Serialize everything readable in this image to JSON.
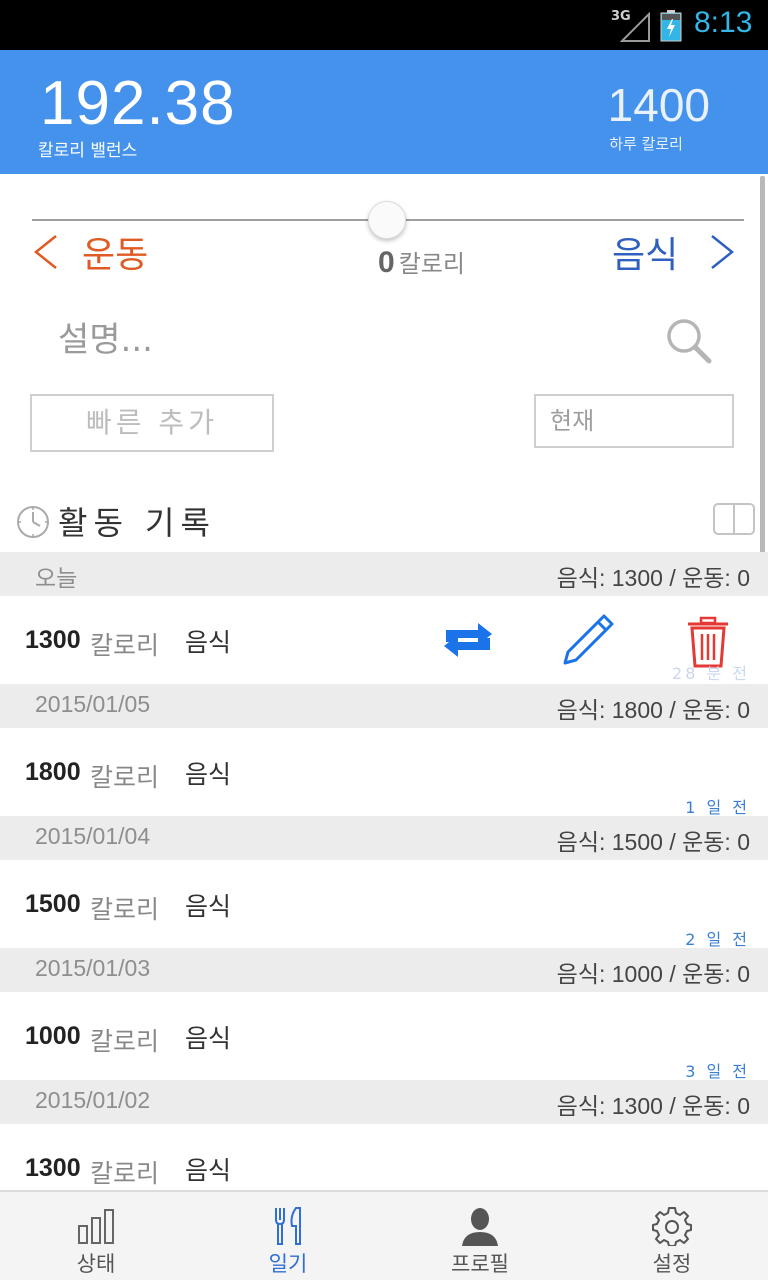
{
  "status_bar": {
    "network": "3G",
    "time": "8:13"
  },
  "header": {
    "balance": "192.38",
    "balance_label": "칼로리 밸런스",
    "daily": "1400",
    "daily_label": "하루 칼로리"
  },
  "slider": {
    "exercise_label": "운동",
    "food_label": "음식",
    "calories_value": "0",
    "calories_unit": "칼로리"
  },
  "search": {
    "placeholder": "설명..."
  },
  "quick_add_label": "빠른 추가",
  "time_field": "현재",
  "log": {
    "title": "활동 기록",
    "days": [
      {
        "date": "오늘",
        "summary": "음식: 1300 / 운동: 0",
        "entry": {
          "value": "1300",
          "unit": "칼로리",
          "kind": "음식",
          "ago": "28 분 전"
        }
      },
      {
        "date": "2015/01/05",
        "summary": "음식: 1800 / 운동: 0",
        "entry": {
          "value": "1800",
          "unit": "칼로리",
          "kind": "음식",
          "ago": "1 일 전"
        }
      },
      {
        "date": "2015/01/04",
        "summary": "음식: 1500 / 운동: 0",
        "entry": {
          "value": "1500",
          "unit": "칼로리",
          "kind": "음식",
          "ago": "2 일 전"
        }
      },
      {
        "date": "2015/01/03",
        "summary": "음식: 1000 / 운동: 0",
        "entry": {
          "value": "1000",
          "unit": "칼로리",
          "kind": "음식",
          "ago": "3 일 전"
        }
      },
      {
        "date": "2015/01/02",
        "summary": "음식: 1300 / 운동: 0",
        "entry": {
          "value": "1300",
          "unit": "칼로리",
          "kind": "음식",
          "ago": ""
        }
      }
    ]
  },
  "nav": {
    "items": [
      {
        "label": "상태",
        "icon": "bar-chart-icon"
      },
      {
        "label": "일기",
        "icon": "fork-knife-icon"
      },
      {
        "label": "프로필",
        "icon": "person-icon"
      },
      {
        "label": "설정",
        "icon": "gear-icon"
      }
    ],
    "active_index": 1
  },
  "colors": {
    "header": "#4592ec",
    "exercise": "#e05a23",
    "food": "#2f5fbf",
    "action_blue": "#1a73e8",
    "delete_red": "#e53935"
  }
}
